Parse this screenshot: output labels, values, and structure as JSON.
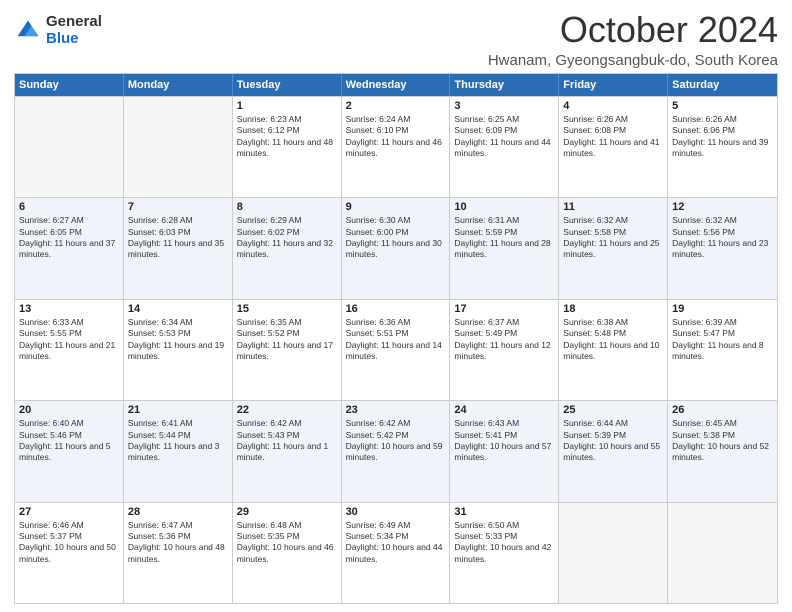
{
  "logo": {
    "general": "General",
    "blue": "Blue"
  },
  "header": {
    "month": "October 2024",
    "subtitle": "Hwanam, Gyeongsangbuk-do, South Korea"
  },
  "days_of_week": [
    "Sunday",
    "Monday",
    "Tuesday",
    "Wednesday",
    "Thursday",
    "Friday",
    "Saturday"
  ],
  "weeks": [
    [
      {
        "num": "",
        "empty": true
      },
      {
        "num": "",
        "empty": true
      },
      {
        "num": "1",
        "sunrise": "Sunrise: 6:23 AM",
        "sunset": "Sunset: 6:12 PM",
        "daylight": "Daylight: 11 hours and 48 minutes."
      },
      {
        "num": "2",
        "sunrise": "Sunrise: 6:24 AM",
        "sunset": "Sunset: 6:10 PM",
        "daylight": "Daylight: 11 hours and 46 minutes."
      },
      {
        "num": "3",
        "sunrise": "Sunrise: 6:25 AM",
        "sunset": "Sunset: 6:09 PM",
        "daylight": "Daylight: 11 hours and 44 minutes."
      },
      {
        "num": "4",
        "sunrise": "Sunrise: 6:26 AM",
        "sunset": "Sunset: 6:08 PM",
        "daylight": "Daylight: 11 hours and 41 minutes."
      },
      {
        "num": "5",
        "sunrise": "Sunrise: 6:26 AM",
        "sunset": "Sunset: 6:06 PM",
        "daylight": "Daylight: 11 hours and 39 minutes."
      }
    ],
    [
      {
        "num": "6",
        "sunrise": "Sunrise: 6:27 AM",
        "sunset": "Sunset: 6:05 PM",
        "daylight": "Daylight: 11 hours and 37 minutes."
      },
      {
        "num": "7",
        "sunrise": "Sunrise: 6:28 AM",
        "sunset": "Sunset: 6:03 PM",
        "daylight": "Daylight: 11 hours and 35 minutes."
      },
      {
        "num": "8",
        "sunrise": "Sunrise: 6:29 AM",
        "sunset": "Sunset: 6:02 PM",
        "daylight": "Daylight: 11 hours and 32 minutes."
      },
      {
        "num": "9",
        "sunrise": "Sunrise: 6:30 AM",
        "sunset": "Sunset: 6:00 PM",
        "daylight": "Daylight: 11 hours and 30 minutes."
      },
      {
        "num": "10",
        "sunrise": "Sunrise: 6:31 AM",
        "sunset": "Sunset: 5:59 PM",
        "daylight": "Daylight: 11 hours and 28 minutes."
      },
      {
        "num": "11",
        "sunrise": "Sunrise: 6:32 AM",
        "sunset": "Sunset: 5:58 PM",
        "daylight": "Daylight: 11 hours and 25 minutes."
      },
      {
        "num": "12",
        "sunrise": "Sunrise: 6:32 AM",
        "sunset": "Sunset: 5:56 PM",
        "daylight": "Daylight: 11 hours and 23 minutes."
      }
    ],
    [
      {
        "num": "13",
        "sunrise": "Sunrise: 6:33 AM",
        "sunset": "Sunset: 5:55 PM",
        "daylight": "Daylight: 11 hours and 21 minutes."
      },
      {
        "num": "14",
        "sunrise": "Sunrise: 6:34 AM",
        "sunset": "Sunset: 5:53 PM",
        "daylight": "Daylight: 11 hours and 19 minutes."
      },
      {
        "num": "15",
        "sunrise": "Sunrise: 6:35 AM",
        "sunset": "Sunset: 5:52 PM",
        "daylight": "Daylight: 11 hours and 17 minutes."
      },
      {
        "num": "16",
        "sunrise": "Sunrise: 6:36 AM",
        "sunset": "Sunset: 5:51 PM",
        "daylight": "Daylight: 11 hours and 14 minutes."
      },
      {
        "num": "17",
        "sunrise": "Sunrise: 6:37 AM",
        "sunset": "Sunset: 5:49 PM",
        "daylight": "Daylight: 11 hours and 12 minutes."
      },
      {
        "num": "18",
        "sunrise": "Sunrise: 6:38 AM",
        "sunset": "Sunset: 5:48 PM",
        "daylight": "Daylight: 11 hours and 10 minutes."
      },
      {
        "num": "19",
        "sunrise": "Sunrise: 6:39 AM",
        "sunset": "Sunset: 5:47 PM",
        "daylight": "Daylight: 11 hours and 8 minutes."
      }
    ],
    [
      {
        "num": "20",
        "sunrise": "Sunrise: 6:40 AM",
        "sunset": "Sunset: 5:46 PM",
        "daylight": "Daylight: 11 hours and 5 minutes."
      },
      {
        "num": "21",
        "sunrise": "Sunrise: 6:41 AM",
        "sunset": "Sunset: 5:44 PM",
        "daylight": "Daylight: 11 hours and 3 minutes."
      },
      {
        "num": "22",
        "sunrise": "Sunrise: 6:42 AM",
        "sunset": "Sunset: 5:43 PM",
        "daylight": "Daylight: 11 hours and 1 minute."
      },
      {
        "num": "23",
        "sunrise": "Sunrise: 6:42 AM",
        "sunset": "Sunset: 5:42 PM",
        "daylight": "Daylight: 10 hours and 59 minutes."
      },
      {
        "num": "24",
        "sunrise": "Sunrise: 6:43 AM",
        "sunset": "Sunset: 5:41 PM",
        "daylight": "Daylight: 10 hours and 57 minutes."
      },
      {
        "num": "25",
        "sunrise": "Sunrise: 6:44 AM",
        "sunset": "Sunset: 5:39 PM",
        "daylight": "Daylight: 10 hours and 55 minutes."
      },
      {
        "num": "26",
        "sunrise": "Sunrise: 6:45 AM",
        "sunset": "Sunset: 5:38 PM",
        "daylight": "Daylight: 10 hours and 52 minutes."
      }
    ],
    [
      {
        "num": "27",
        "sunrise": "Sunrise: 6:46 AM",
        "sunset": "Sunset: 5:37 PM",
        "daylight": "Daylight: 10 hours and 50 minutes."
      },
      {
        "num": "28",
        "sunrise": "Sunrise: 6:47 AM",
        "sunset": "Sunset: 5:36 PM",
        "daylight": "Daylight: 10 hours and 48 minutes."
      },
      {
        "num": "29",
        "sunrise": "Sunrise: 6:48 AM",
        "sunset": "Sunset: 5:35 PM",
        "daylight": "Daylight: 10 hours and 46 minutes."
      },
      {
        "num": "30",
        "sunrise": "Sunrise: 6:49 AM",
        "sunset": "Sunset: 5:34 PM",
        "daylight": "Daylight: 10 hours and 44 minutes."
      },
      {
        "num": "31",
        "sunrise": "Sunrise: 6:50 AM",
        "sunset": "Sunset: 5:33 PM",
        "daylight": "Daylight: 10 hours and 42 minutes."
      },
      {
        "num": "",
        "empty": true
      },
      {
        "num": "",
        "empty": true
      }
    ]
  ]
}
